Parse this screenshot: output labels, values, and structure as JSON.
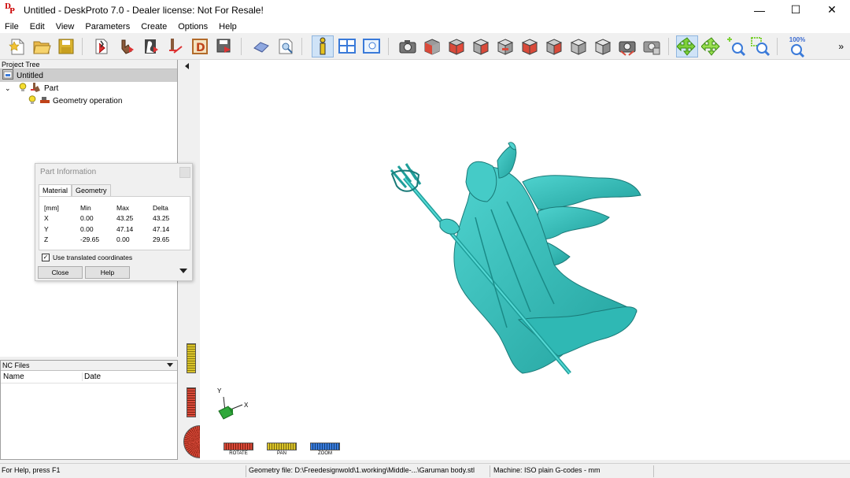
{
  "window": {
    "title": "Untitled - DeskProto 7.0 - Dealer license: Not For Resale!",
    "controls": [
      "—",
      "☐",
      "✕"
    ]
  },
  "menu": [
    "File",
    "Edit",
    "View",
    "Parameters",
    "Create",
    "Options",
    "Help"
  ],
  "toolbar": {
    "zoom_label": "100%",
    "more": "»"
  },
  "project_tree": {
    "header": "Project Tree",
    "root": "Untitled",
    "part": "Part",
    "operation": "Geometry operation"
  },
  "nc_files": {
    "header": "NC Files",
    "col_name": "Name",
    "col_date": "Date"
  },
  "part_info": {
    "title": "Part Information",
    "tabs": [
      "Material",
      "Geometry"
    ],
    "columns": [
      "[mm]",
      "Min",
      "Max",
      "Delta"
    ],
    "rows": [
      [
        "X",
        "0.00",
        "43.25",
        "43.25"
      ],
      [
        "Y",
        "0.00",
        "47.14",
        "47.14"
      ],
      [
        "Z",
        "-29.65",
        "0.00",
        "29.65"
      ]
    ],
    "checkbox_label": "Use translated coordinates",
    "checkbox_checked": true,
    "close": "Close",
    "help": "Help"
  },
  "axes": {
    "y": "Y",
    "x": "X"
  },
  "controls": {
    "rotate": "ROTATE",
    "pan": "PAN",
    "zoom": "ZOOM"
  },
  "status": {
    "help": "For Help, press F1",
    "geometry": "Geometry file: D:\\Freedesignwold\\1.working\\Middle-...\\Garuman body.stl",
    "machine": "Machine: ISO plain G-codes - mm"
  },
  "colors": {
    "model": "#3cbfbb",
    "model_dark": "#1f8f8c",
    "accent_red": "#d94a3a",
    "accent_yellow": "#d9c32a",
    "accent_blue": "#3a7ad9"
  }
}
